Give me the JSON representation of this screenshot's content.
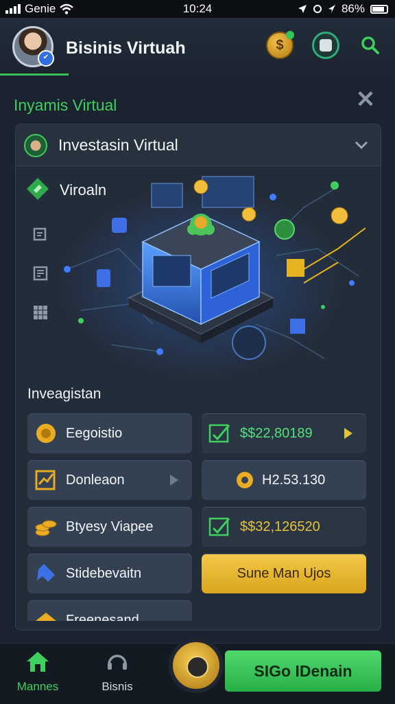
{
  "status_bar": {
    "carrier": "Genie",
    "time": "10:24",
    "battery": "86%"
  },
  "header": {
    "title": "Bisinis Virtuah"
  },
  "section": {
    "title": "Inyamis Virtual"
  },
  "panel": {
    "header_title": "Investasin Virtual",
    "feature_label": "Viroaln",
    "list_title": "Inveagistan"
  },
  "cards": [
    {
      "label": "Eegoistio"
    },
    {
      "label": "$$22,80189"
    },
    {
      "label": "Donleaon"
    },
    {
      "label": "H2.53.130"
    },
    {
      "label": "Btyesy Viapee"
    },
    {
      "label": "$$32,126520"
    },
    {
      "label": "Stidebevaitn"
    },
    {
      "label": "Sune Man Ujos"
    },
    {
      "label": "Freenesand"
    }
  ],
  "bottom_nav": {
    "home_label": "Mannes",
    "business_label": "Bisnis",
    "cta_label": "SIGo IDenain"
  },
  "colors": {
    "accent_green": "#3fcf5e",
    "gold": "#f3c94a",
    "background": "#1b2330"
  }
}
